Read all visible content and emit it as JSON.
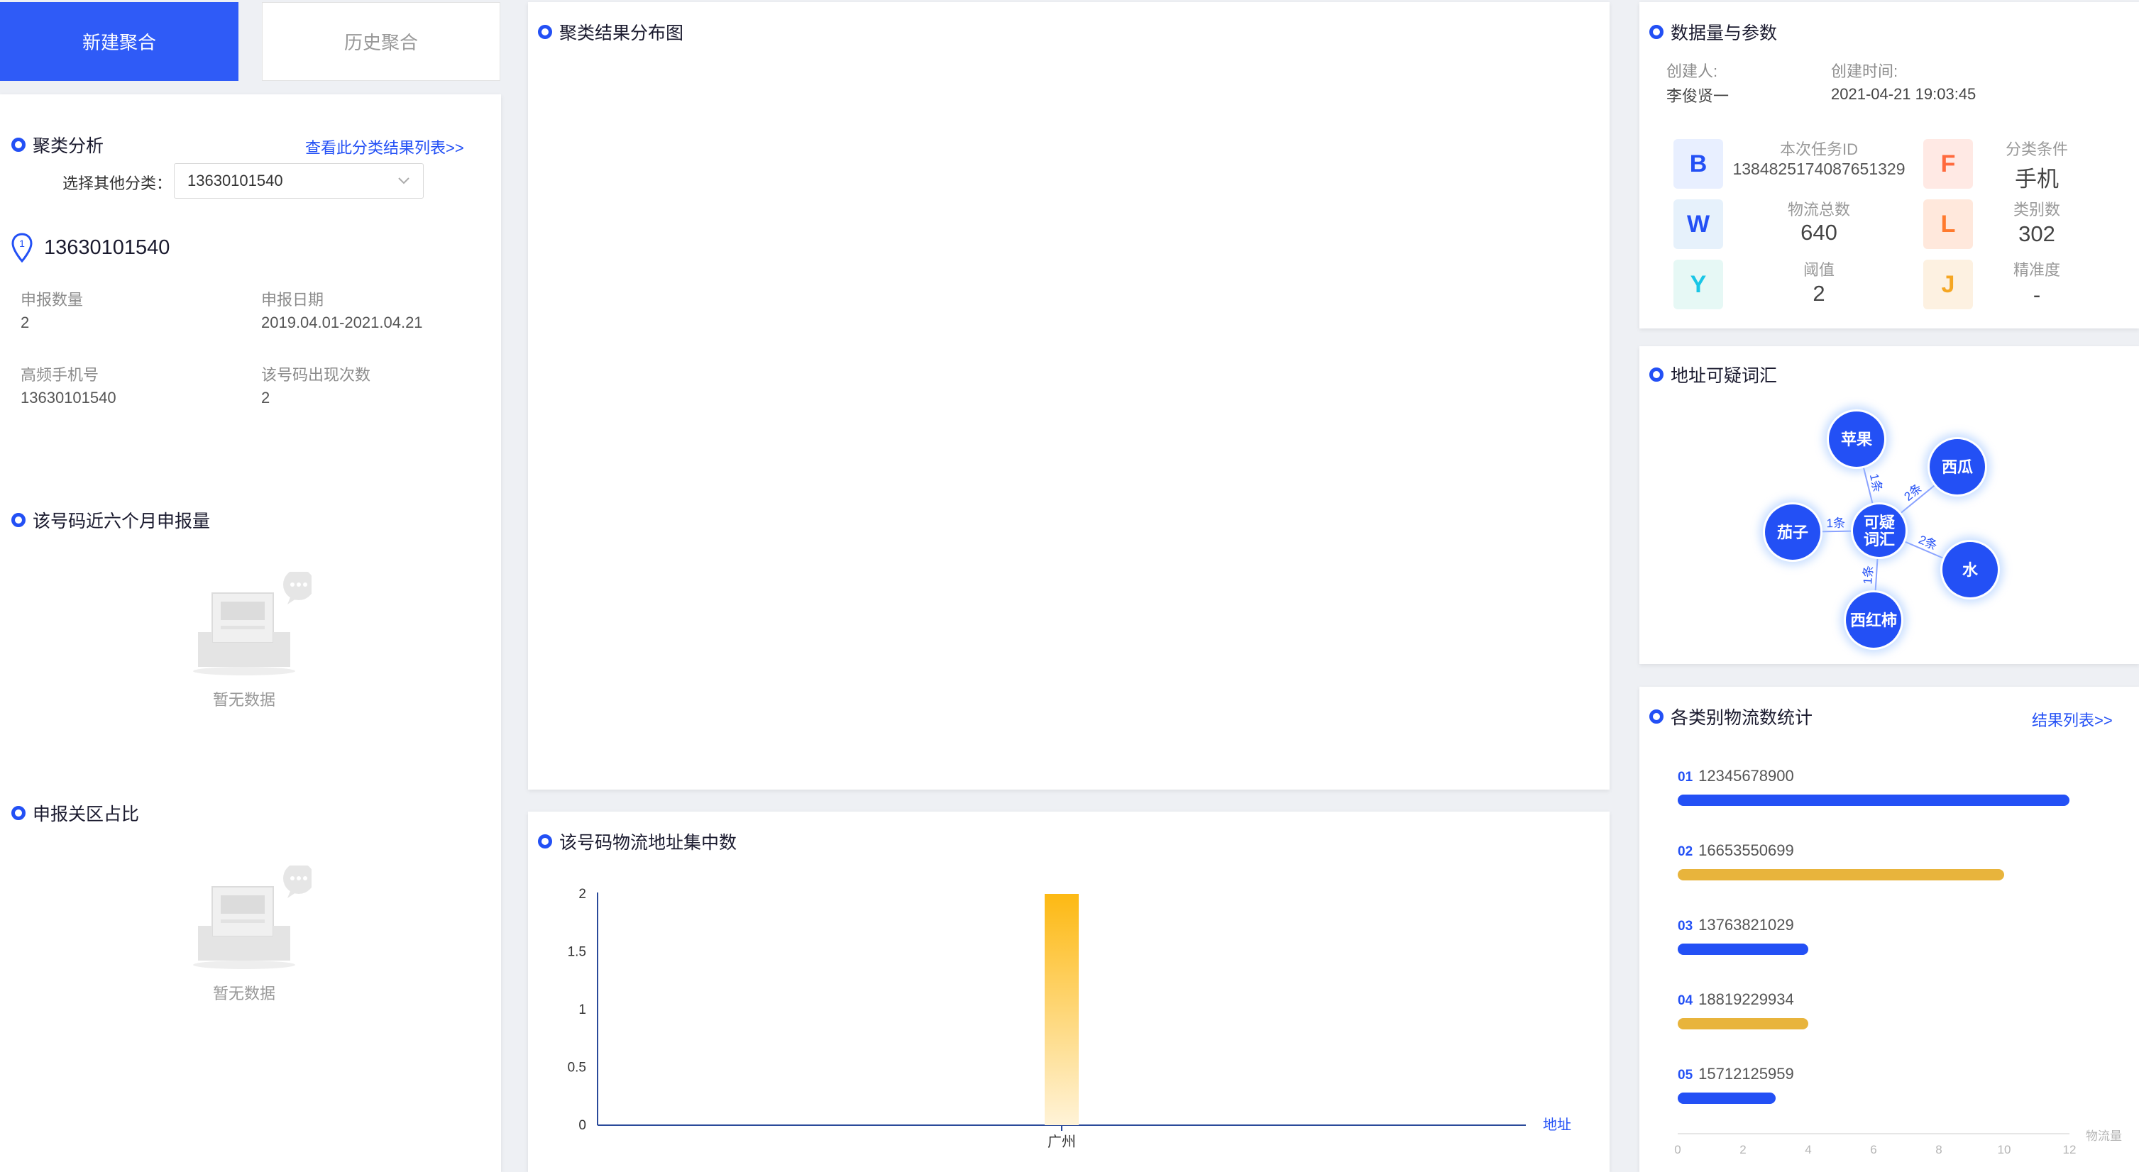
{
  "tabs": {
    "new_label": "新建聚合",
    "history_label": "历史聚合"
  },
  "cluster": {
    "title": "聚类分析",
    "view_list_link": "查看此分类结果列表>>",
    "select_label": "选择其他分类：",
    "select_value": "13630101540",
    "marker_number": "1",
    "phone": "13630101540",
    "fields": {
      "count_label": "申报数量",
      "count_value": "2",
      "date_label": "申报日期",
      "date_value": "2019.04.01-2021.04.21",
      "freq_phone_label": "高频手机号",
      "freq_phone_value": "13630101540",
      "appear_label": "该号码出现次数",
      "appear_value": "2"
    }
  },
  "six_month": {
    "title": "该号码近六个月申报量",
    "empty": "暂无数据"
  },
  "customs_ratio": {
    "title": "申报关区占比",
    "empty": "暂无数据"
  },
  "distribution": {
    "title": "聚类结果分布图"
  },
  "address_concentration": {
    "title": "该号码物流地址集中数",
    "chart_data": {
      "type": "bar",
      "categories": [
        "广州"
      ],
      "values": [
        2
      ],
      "xlabel": "地址",
      "ylabel": "",
      "ylim": [
        0,
        2
      ],
      "yticks": [
        "0",
        "0.5",
        "1",
        "1.5",
        "2"
      ],
      "bar_color": "#fdb913"
    }
  },
  "params": {
    "title": "数据量与参数",
    "creator_label": "创建人:",
    "creator_value": "李俊贤一",
    "time_label": "创建时间:",
    "time_value": "2021-04-21 19:03:45",
    "tiles": [
      {
        "letter": "B",
        "label": "本次任务ID",
        "value": "1384825174087651329",
        "fg": "#2350f5",
        "bg": "#e8efff"
      },
      {
        "letter": "F",
        "label": "分类条件",
        "value": "手机",
        "fg": "#ff6a3d",
        "bg": "#ffe9e4"
      },
      {
        "letter": "W",
        "label": "物流总数",
        "value": "640",
        "fg": "#2350f5",
        "bg": "#e6f1fb"
      },
      {
        "letter": "L",
        "label": "类别数",
        "value": "302",
        "fg": "#ff7a2e",
        "bg": "#ffe8dc"
      },
      {
        "letter": "Y",
        "label": "阈值",
        "value": "2",
        "fg": "#19c6e6",
        "bg": "#e6f8f5"
      },
      {
        "letter": "J",
        "label": "精准度",
        "value": "-",
        "fg": "#f5a623",
        "bg": "#fdf1e1"
      }
    ]
  },
  "suspicious": {
    "title": "地址可疑词汇",
    "center": "可疑\n词汇",
    "nodes": [
      {
        "label": "苹果",
        "edge": "1条"
      },
      {
        "label": "西瓜",
        "edge": "2条"
      },
      {
        "label": "茄子",
        "edge": "1条"
      },
      {
        "label": "水",
        "edge": "2条"
      },
      {
        "label": "西红柿",
        "edge": "1条"
      }
    ]
  },
  "logistics_stats": {
    "title": "各类别物流数统计",
    "link": "结果列表>>",
    "axis_label": "物流量",
    "chart_data": {
      "type": "bar",
      "orientation": "horizontal",
      "categories": [
        "12345678900",
        "16653550699",
        "13763821029",
        "18819229934",
        "15712125959"
      ],
      "ranks": [
        "01",
        "02",
        "03",
        "04",
        "05"
      ],
      "values": [
        12,
        10,
        4,
        4,
        3
      ],
      "colors": [
        "#2350f5",
        "#e8b43c",
        "#2350f5",
        "#e8b43c",
        "#2350f5"
      ],
      "xlim": [
        0,
        12
      ],
      "xticks": [
        "0",
        "2",
        "4",
        "6",
        "8",
        "10",
        "12"
      ],
      "xlabel": "物流量"
    }
  }
}
